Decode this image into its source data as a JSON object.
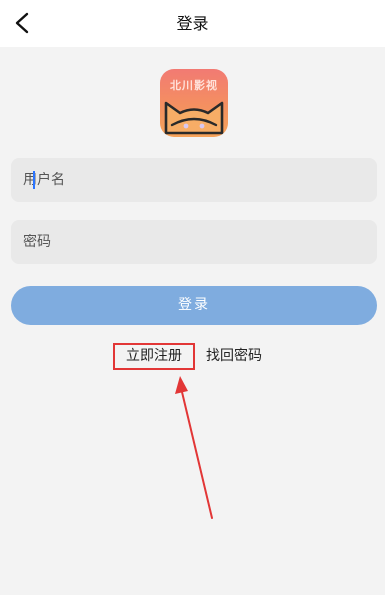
{
  "header": {
    "title": "登录"
  },
  "logo": {
    "text": "北川影视"
  },
  "username": {
    "placeholder": "用户名"
  },
  "password": {
    "placeholder": "密码"
  },
  "login_button": {
    "label": "登录"
  },
  "links": {
    "register": "立即注册",
    "forgot_password": "找回密码"
  },
  "colors": {
    "primary_button": "#7facdf",
    "highlight_box": "#e23636",
    "field_bg": "#e9e9e9",
    "page_bg": "#f3f3f3"
  }
}
